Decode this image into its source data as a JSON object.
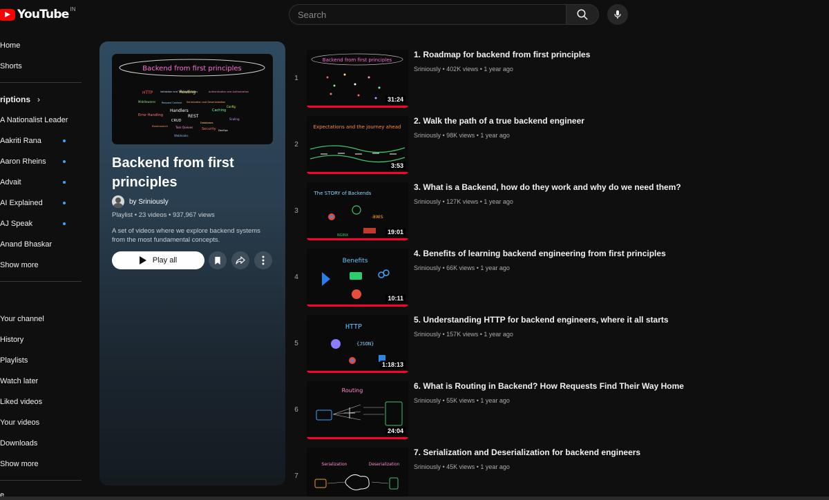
{
  "header": {
    "logo_text": "YouTube",
    "country_code": "IN",
    "search_placeholder": "Search"
  },
  "sidebar": {
    "top_items": [
      {
        "label": "Home"
      },
      {
        "label": "Shorts"
      }
    ],
    "subscriptions_title": "riptions",
    "subscriptions": [
      {
        "label": "A Nationalist Leader",
        "new": false
      },
      {
        "label": "Aakriti Rana",
        "new": true
      },
      {
        "label": "Aaron Rheins",
        "new": true
      },
      {
        "label": "Advait",
        "new": true
      },
      {
        "label": "AI Explained",
        "new": true
      },
      {
        "label": "AJ Speak",
        "new": true
      },
      {
        "label": "Anand Bhaskar",
        "new": false
      },
      {
        "label": "Show more",
        "new": false
      }
    ],
    "you_items": [
      {
        "label": "Your channel"
      },
      {
        "label": "History"
      },
      {
        "label": "Playlists"
      },
      {
        "label": "Watch later"
      },
      {
        "label": "Liked videos"
      },
      {
        "label": "Your videos"
      },
      {
        "label": "Downloads"
      },
      {
        "label": "Show more"
      }
    ],
    "bottom_cut_label": "e"
  },
  "playlist": {
    "thumb_title": "Backend from first principles",
    "thumb_words": [
      "HTTP",
      "Validation and Transformations",
      "Routing",
      "Authentication and Authorization",
      "Middlewares",
      "Request Context",
      "Serialization and Deserialization",
      "Caching",
      "Handlers",
      "REST",
      "Config",
      "Error Handling",
      "CRUD",
      "Databases",
      "Elasticsearch",
      "Task Queues",
      "Security",
      "Scaling",
      "Webhooks",
      "DevOps"
    ],
    "title": "Backend from first principles",
    "owner": "by Sriniously",
    "meta": "Playlist • 23 videos • 937,967 views",
    "description": "A set of videos where we explore backend systems from the most fundamental concepts.",
    "play_all_label": "Play all"
  },
  "videos": [
    {
      "index": "1",
      "title": "1. Roadmap for backend from first principles",
      "channel": "Sriniously",
      "views": "402K views",
      "age": "1 year ago",
      "duration": "31:24",
      "thumb_text": "Backend from first principles"
    },
    {
      "index": "2",
      "title": "2. Walk the path of a true backend engineer",
      "channel": "Sriniously",
      "views": "98K views",
      "age": "1 year ago",
      "duration": "3:53",
      "thumb_text": "Expectations and the journey ahead"
    },
    {
      "index": "3",
      "title": "3. What is a Backend, how do they work and why do we need them?",
      "channel": "Sriniously",
      "views": "127K views",
      "age": "1 year ago",
      "duration": "19:01",
      "thumb_text": "The STORY of Backends"
    },
    {
      "index": "4",
      "title": "4. Benefits of learning backend engineering from first principles",
      "channel": "Sriniously",
      "views": "66K views",
      "age": "1 year ago",
      "duration": "10:11",
      "thumb_text": "Benefits"
    },
    {
      "index": "5",
      "title": "5. Understanding HTTP for backend engineers, where it all starts",
      "channel": "Sriniously",
      "views": "157K views",
      "age": "1 year ago",
      "duration": "1:18:13",
      "thumb_text": "HTTP"
    },
    {
      "index": "6",
      "title": "6. What is Routing in Backend? How Requests Find Their Way Home",
      "channel": "Sriniously",
      "views": "55K views",
      "age": "1 year ago",
      "duration": "24:04",
      "thumb_text": "Routing"
    },
    {
      "index": "7",
      "title": "7. Serialization and Deserialization for backend engineers",
      "channel": "Sriniously",
      "views": "45K views",
      "age": "1 year ago",
      "duration": "",
      "thumb_text": "Serialization"
    }
  ],
  "colors": {
    "background": "#0f0f0f",
    "brand_red": "#ff0000",
    "progress_red": "#ff0033",
    "new_dot": "#3ea6ff"
  }
}
